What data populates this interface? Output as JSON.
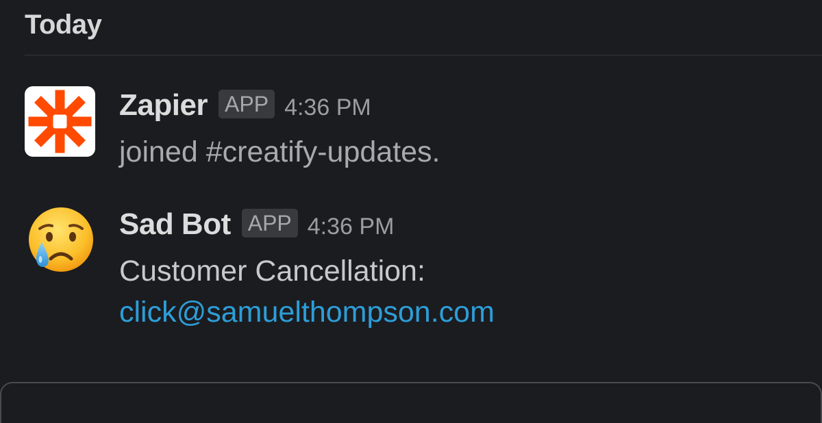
{
  "header": {
    "day_label": "Today"
  },
  "messages": [
    {
      "sender": "Zapier",
      "badge": "APP",
      "time": "4:36 PM",
      "text": "joined #creatify-updates.",
      "avatar_icon": "zapier-asterisk-icon",
      "avatar_color": "#ff4a00"
    },
    {
      "sender": "Sad Bot",
      "badge": "APP",
      "time": "4:36 PM",
      "text": "Customer Cancellation:",
      "link": "click@samuelthompson.com",
      "avatar_icon": "crying-face-emoji-icon",
      "link_color": "#2d9ed8"
    }
  ]
}
